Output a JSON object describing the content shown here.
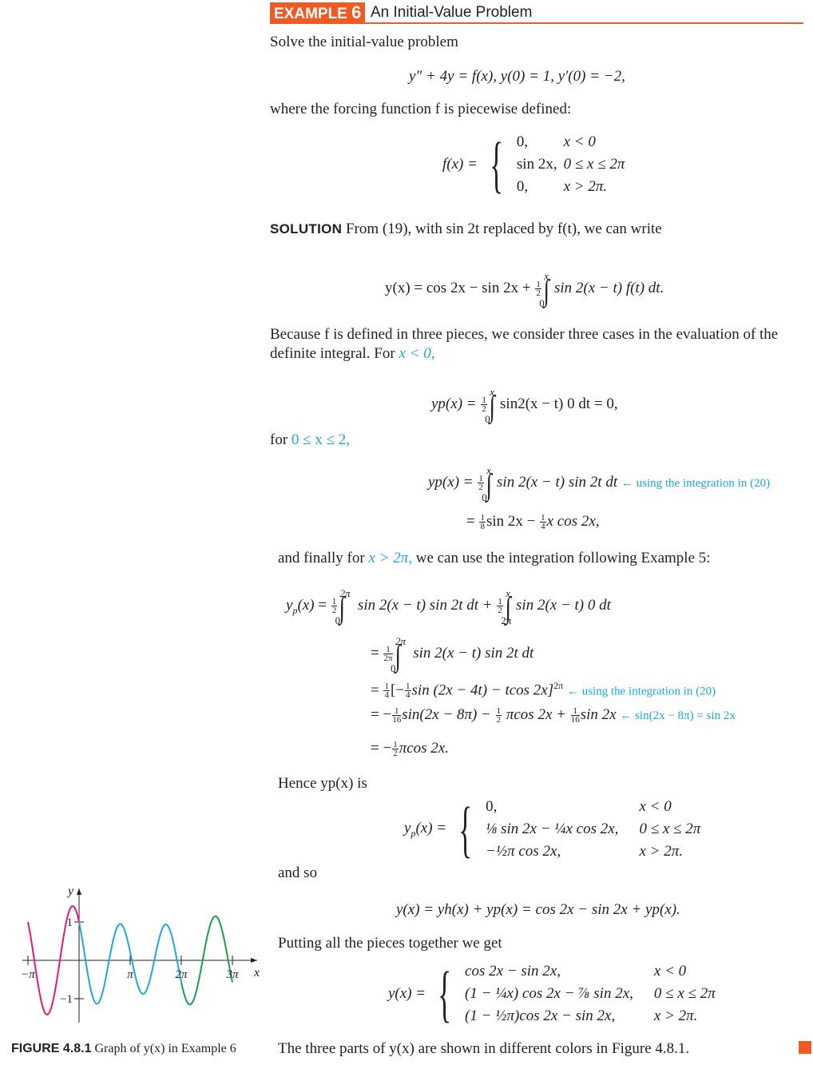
{
  "header": {
    "tag_word": "EXAMPLE",
    "tag_number": "6",
    "title": "An Initial-Value Problem",
    "accent_color": "#f15a22"
  },
  "intro": {
    "line1": "Solve the initial-value problem",
    "ivp": "y″ + 4y = f(x),   y(0) = 1, y′(0) = −2,",
    "line2": "where the forcing function f is piecewise defined:"
  },
  "forcing": {
    "lhs": "f(x) =",
    "cases": [
      {
        "expr": "0,",
        "cond": "x < 0"
      },
      {
        "expr": "sin 2x,",
        "cond": "0 ≤ x ≤ 2π"
      },
      {
        "expr": "0,",
        "cond": "x > 2π."
      }
    ]
  },
  "solution": {
    "label": "SOLUTION",
    "text": "From (19), with sin 2t replaced by f(t), we can write",
    "eq_lhs": "y(x) = cos 2x − sin 2x + ",
    "eq_integrand": "sin 2(x − t) f(t) dt.",
    "because": "Because f is defined in three pieces, we consider three cases in the evaluation of the",
    "definite": "definite integral. For ",
    "cond_neg": "x < 0,",
    "yp_neg_lhs": "yp(x) = ",
    "yp_neg_integrand": "sin2(x − t) 0 dt = 0,",
    "for_label": "for ",
    "cond_mid": "0 ≤ x ≤ 2,",
    "yp_mid_lhs": "yp(x)  = ",
    "yp_mid_integrand": "sin 2(x − t) sin 2t dt",
    "note_integration": "← using the integration in (20)",
    "yp_mid_result": "sin 2x − ",
    "yp_mid_result2": "x cos 2x,",
    "finally_text1": "and finally for ",
    "cond_big": "x > 2π,",
    "finally_text2": " we can use the integration following Example 5:",
    "yp_big_line1a": "sin 2(x − t) sin 2t dt + ",
    "yp_big_line1b": "sin 2(x − t) 0 dt",
    "yp_big_line2": "sin 2(x − t) sin 2t dt",
    "yp_big_line3a": "[−",
    "yp_big_line3b": "sin (2x − 4t) − tcos 2x]",
    "yp_big_line4a": "sin(2x − 8π) − ",
    "yp_big_line4b": " πcos 2x + ",
    "yp_big_line4c": "sin 2x",
    "note_sin": "← sin(2x − 8π) = sin 2x",
    "yp_big_line5": "πcos 2x.",
    "hence": "Hence yp(x) is",
    "yp_cases": [
      {
        "expr": "0,",
        "cond": "x < 0"
      },
      {
        "expr": "⅛ sin 2x − ¼x cos 2x,",
        "cond": "0 ≤ x ≤ 2π"
      },
      {
        "expr": "−½π cos 2x,",
        "cond": "x > 2π."
      }
    ],
    "and_so": "and so",
    "y_sum": "y(x) = yh(x) + yp(x) = cos 2x − sin 2x + yp(x).",
    "putting": "Putting all the pieces together we get",
    "y_cases": [
      {
        "expr": "cos 2x − sin 2x,",
        "cond": "x < 0"
      },
      {
        "expr": "(1 − ¼x) cos 2x − ⅞ sin 2x,",
        "cond": "0 ≤ x ≤ 2π"
      },
      {
        "expr": "(1 − ½π)cos 2x − sin 2x,",
        "cond": "x > 2π."
      }
    ],
    "closing": "The three parts of y(x) are shown in different colors in Figure 4.8.1."
  },
  "figure": {
    "caption_label": "FIGURE 4.8.1",
    "caption_text": "Graph of y(x) in Example 6"
  },
  "chart_data": {
    "type": "line",
    "title": "Graph of y(x) in Example 6",
    "xlabel": "x",
    "ylabel": "y",
    "x_ticks": [
      "−π",
      "π",
      "2π",
      "3π"
    ],
    "y_ticks": [
      "1",
      "−1"
    ],
    "xlim": [
      -3.1416,
      9.4248
    ],
    "ylim": [
      -1.5,
      1.5
    ],
    "grid": false,
    "series": [
      {
        "name": "x < 0",
        "formula": "cos 2x − sin 2x",
        "domain": [
          -3.1416,
          0
        ],
        "color": "#e8177a"
      },
      {
        "name": "0 ≤ x ≤ 2π",
        "formula": "(1 − x/4) cos 2x − (7/8) sin 2x",
        "domain": [
          0,
          6.2832
        ],
        "color": "#1ea7e1"
      },
      {
        "name": "x > 2π",
        "formula": "(1 − π/2) cos 2x − sin 2x",
        "domain": [
          6.2832,
          9.4248
        ],
        "color": "#1a9f4a"
      }
    ]
  }
}
